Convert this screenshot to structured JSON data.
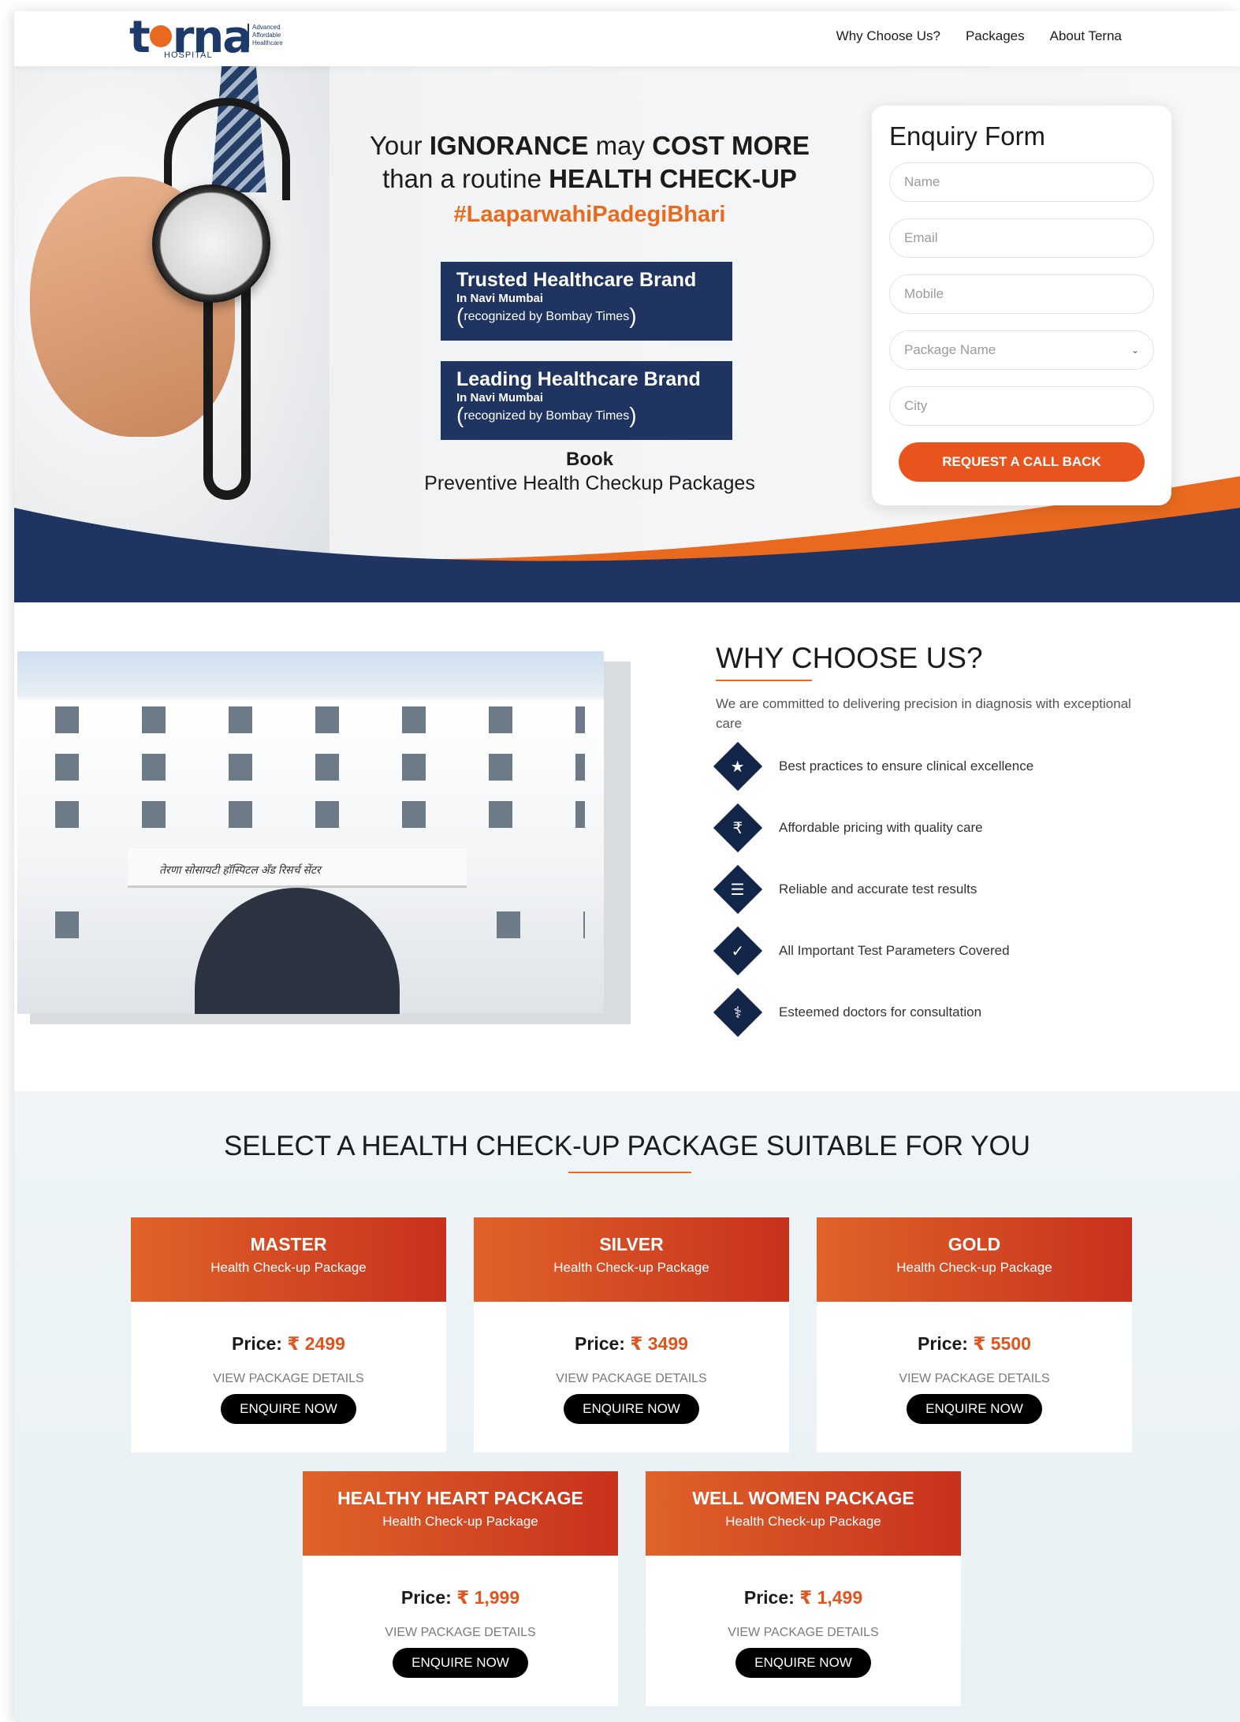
{
  "header": {
    "logo_text": "terna",
    "logo_sub": "HOSPITAL",
    "logo_tag": [
      "Advanced",
      "Affordable",
      "Healthcare"
    ],
    "nav": [
      "Why Choose Us?",
      "Packages",
      "About Terna"
    ]
  },
  "hero": {
    "headline_1a": "Your ",
    "headline_1b": "IGNORANCE",
    "headline_1c": " may ",
    "headline_1d": "COST MORE",
    "headline_2a": "than a routine ",
    "headline_2b": "HEALTH CHECK-UP",
    "hashtag": "#LaaparwahiPadegiBhari",
    "badges": [
      {
        "title": "Trusted Healthcare Brand",
        "place": "In Navi Mumbai",
        "note": "recognized by Bombay Times"
      },
      {
        "title": "Leading Healthcare Brand",
        "place": "In Navi Mumbai",
        "note": "recognized by Bombay Times"
      }
    ],
    "book_1": "Book",
    "book_2": "Preventive Health Checkup Packages"
  },
  "form": {
    "title": "Enquiry Form",
    "name_placeholder": "Name",
    "email_placeholder": "Email",
    "mobile_placeholder": "Mobile",
    "package_placeholder": "Package Name",
    "city_placeholder": "City",
    "submit": "REQUEST A CALL BACK"
  },
  "why": {
    "building_sign": "तेरणा सोसायटी हॉस्पिटल अँड रिसर्च सेंटर",
    "title": "WHY CHOOSE US?",
    "description": "We are committed to delivering precision in diagnosis with exceptional care",
    "items": [
      {
        "icon": "award-icon",
        "text": "Best practices to ensure clinical excellence"
      },
      {
        "icon": "rupee-hand-icon",
        "text": "Affordable pricing with quality care"
      },
      {
        "icon": "report-icon",
        "text": "Reliable and accurate test results"
      },
      {
        "icon": "checklist-icon",
        "text": "All Important Test Parameters Covered"
      },
      {
        "icon": "doctor-icon",
        "text": "Esteemed doctors for consultation"
      }
    ]
  },
  "packages": {
    "title": "SELECT A HEALTH CHECK-UP PACKAGE SUITABLE FOR YOU",
    "price_label": "Price:",
    "details_label": "VIEW PACKAGE DETAILS",
    "enquire_label": "ENQUIRE NOW",
    "cards": [
      {
        "name": "MASTER",
        "sub": "Health Check-up Package",
        "price": "₹ 2499"
      },
      {
        "name": "SILVER",
        "sub": "Health Check-up Package",
        "price": "₹ 3499"
      },
      {
        "name": "GOLD",
        "sub": "Health Check-up Package",
        "price": "₹ 5500"
      },
      {
        "name": "HEALTHY HEART PACKAGE",
        "sub": "Health Check-up Package",
        "price": "₹ 1,999"
      },
      {
        "name": "WELL WOMEN PACKAGE",
        "sub": "Health Check-up Package",
        "price": "₹ 1,499"
      }
    ]
  },
  "colors": {
    "accent": "#e96a1e",
    "navy": "#1f3461",
    "cta": "#e9541e"
  }
}
